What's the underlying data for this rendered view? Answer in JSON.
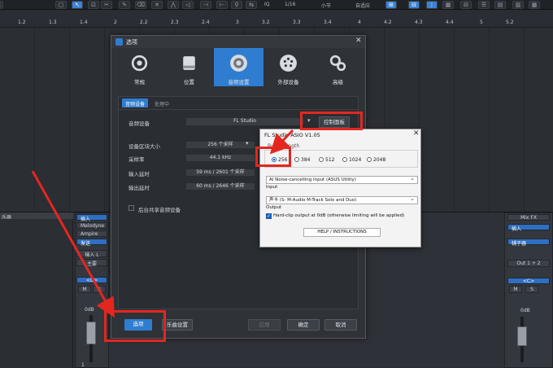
{
  "toolbar": {
    "iq_label": "IQ",
    "snap_value": "1/16",
    "snap_mode": "小节",
    "snap_adapt": "自适应"
  },
  "ruler": {
    "ticks": [
      "1.2",
      "1.3",
      "1.4",
      "2",
      "2.2",
      "2.3",
      "2.4",
      "3",
      "3.2",
      "3.3",
      "3.4",
      "4",
      "4.2",
      "4.3",
      "4.4",
      "5",
      "5.2"
    ]
  },
  "mixer": {
    "left_label": "乐器",
    "inserts_label": "插入",
    "insert_1": "Melodyne",
    "insert_2": "Ampire",
    "sends_label": "发送",
    "input_label": "输入 L",
    "main_label": "主要",
    "center_label": "<C>",
    "mute_label": "M",
    "solo_label": "S",
    "db_label": "0dB",
    "track_number": "1",
    "right_mix_fx": "Mix FX",
    "right_inserts": "插入",
    "right_sends": "辅子器",
    "right_output": "Out 1 + 2",
    "right_center": "<C>",
    "right_db": "0dB"
  },
  "dialog": {
    "title": "选项",
    "categories": [
      {
        "label": "常规",
        "icon": "gear-icon"
      },
      {
        "label": "位置",
        "icon": "drive-icon"
      },
      {
        "label": "音频设置",
        "icon": "speaker-icon"
      },
      {
        "label": "外部设备",
        "icon": "midi-icon"
      },
      {
        "label": "高级",
        "icon": "gears-icon"
      }
    ],
    "tabs": [
      "音频设备",
      "处理中"
    ],
    "audio_device_label": "音频设备",
    "audio_device_value": "FL Studio",
    "control_panel_button": "控制面板",
    "block_size_label": "设备区块大小",
    "block_size_value": "256 个采样",
    "sample_rate_label": "采样率",
    "sample_rate_value": "44.1 kHz",
    "input_latency_label": "输入延时",
    "input_latency_value": "59 ms / 2601 个采样",
    "output_latency_label": "输出延时",
    "output_latency_value": "60 ms / 2646 个采样",
    "background_share_label": "后台共享音频设备",
    "options_button": "选项",
    "app_settings_button": "乐曲设置",
    "apply_button": "应用",
    "ok_button": "确定",
    "cancel_button": "取消"
  },
  "asio": {
    "title": "FL Studio ASIO V1.05",
    "buffer_label": "Buffer length",
    "buffer_options": [
      "256",
      "384",
      "512",
      "1024",
      "2048"
    ],
    "buffer_selected": "256",
    "device_value": "AI Noise-cancelling Input (ASUS Utility)",
    "input_label": "Input",
    "input_value": "声卡 (S- M-Audio M-Track Solo and Duo)",
    "output_label": "Output",
    "hard_clip_label": "Hard-clip output at 0dB (otherwise limiting will be applied)",
    "help_button": "HELP / INSTRUCTIONS"
  },
  "colors": {
    "accent": "#2f7dd0",
    "annotation": "#e3271f"
  }
}
